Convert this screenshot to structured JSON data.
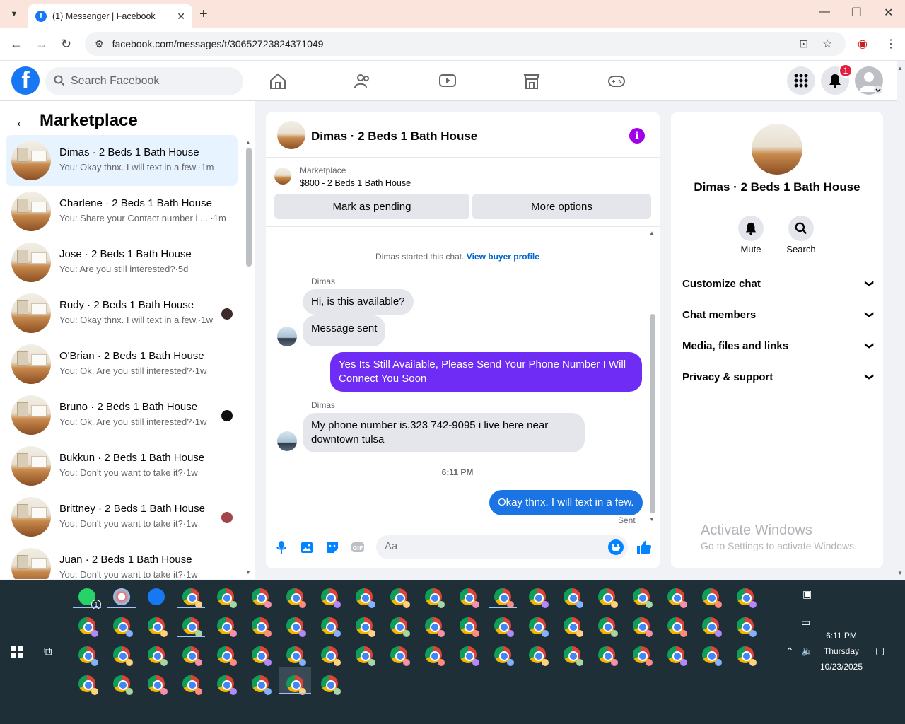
{
  "browser": {
    "tab_title": "(1) Messenger | Facebook",
    "url": "facebook.com/messages/t/30652723824371049",
    "new_tab": "+",
    "close_tab": "✕",
    "minimize": "—",
    "maximize": "❐",
    "close_window": "✕"
  },
  "header": {
    "search_placeholder": "Search Facebook",
    "notification_count": "1",
    "logo_letter": "f"
  },
  "chat_list": {
    "title": "Marketplace",
    "items": [
      {
        "name": "Dimas · 2 Beds 1 Bath House",
        "preview": "You: Okay thnx. I will text in a few.·1m",
        "active": true
      },
      {
        "name": "Charlene · 2 Beds 1 Bath House",
        "preview": "You: Share your Contact number i ... ·1m"
      },
      {
        "name": "Jose · 2 Beds 1 Bath House",
        "preview": "You: Are you still interested?·5d"
      },
      {
        "name": "Rudy · 2 Beds 1 Bath House",
        "preview": "You: Okay thnx. I will text in a few.·1w"
      },
      {
        "name": "O'Brian · 2 Beds 1 Bath House",
        "preview": "You: Ok, Are you still interested?·1w"
      },
      {
        "name": "Bruno · 2 Beds 1 Bath House",
        "preview": "You: Ok, Are you still interested?·1w"
      },
      {
        "name": "Bukkun · 2 Beds 1 Bath House",
        "preview": "You: Don't you want to take it?·1w"
      },
      {
        "name": "Brittney · 2 Beds 1 Bath House",
        "preview": "You: Don't you want to take it?·1w"
      },
      {
        "name": "Juan · 2 Beds 1 Bath House",
        "preview": "You: Don't you want to take it?·1w"
      }
    ]
  },
  "conversation": {
    "title": "Dimas · 2 Beds 1 Bath House",
    "marketplace_label": "Marketplace",
    "listing": "$800 - 2 Beds 1 Bath House",
    "mark_pending": "Mark as pending",
    "more_options": "More options",
    "started_text": "Dimas started this chat.",
    "view_profile": "View buyer profile",
    "sender1": "Dimas",
    "msg1": "Hi, is this available?",
    "msg2": "Message sent",
    "msg3": "Yes Its Still Available, Please Send Your Phone Number I Will Connect You Soon",
    "sender2": "Dimas",
    "msg4": "My phone number is.323 742-9095  i live here near downtown tulsa",
    "timestamp": "6:11 PM",
    "msg5": "Okay thnx. I will text in a few.",
    "sent_label": "Sent",
    "composer_placeholder": "Aa",
    "outgoing_color_1": "#6e2cf5",
    "outgoing_color_2": "#1b74e4"
  },
  "details": {
    "name": "Dimas · 2 Beds 1 Bath House",
    "mute": "Mute",
    "search": "Search",
    "rows": [
      "Customize chat",
      "Chat members",
      "Media, files and links",
      "Privacy & support"
    ]
  },
  "watermark": {
    "line1": "Activate Windows",
    "line2": "Go to Settings to activate Windows."
  },
  "taskbar": {
    "time": "6:11 PM",
    "day": "Thursday",
    "date": "10/23/2025",
    "whatsapp_badge": "1"
  }
}
